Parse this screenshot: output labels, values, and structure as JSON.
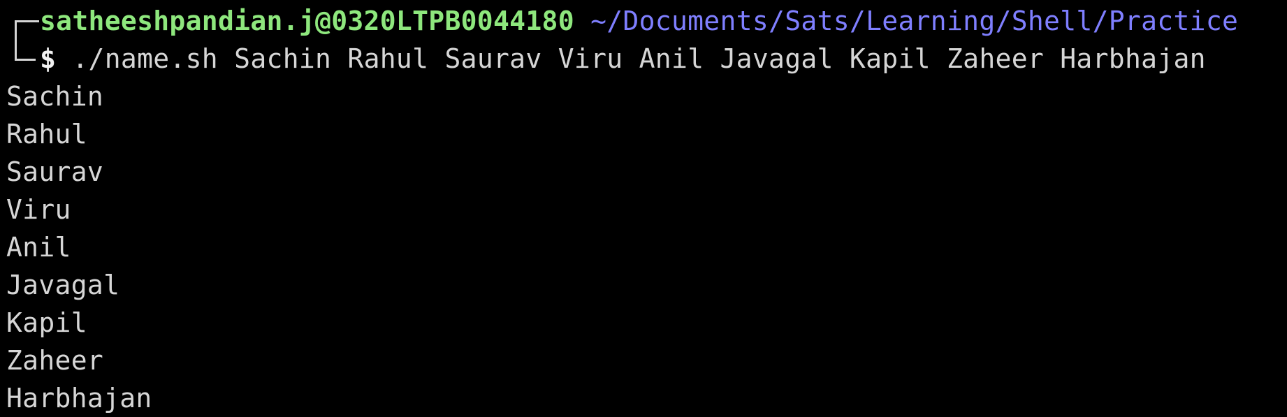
{
  "prompt": {
    "user_host": "satheeshpandian.j@0320LTPB0044180",
    "cwd": "~/Documents/Sats/Learning/Shell/Practice",
    "symbol": "$",
    "command": "./name.sh Sachin Rahul Saurav Viru Anil Javagal Kapil Zaheer Harbhajan"
  },
  "output": {
    "lines": [
      "Sachin",
      "Rahul",
      "Saurav",
      "Viru",
      "Anil",
      "Javagal",
      "Kapil",
      "Zaheer",
      "Harbhajan"
    ]
  },
  "colors": {
    "background": "#000000",
    "user_host": "#8ee77d",
    "cwd": "#7f7fff",
    "text": "#d6d6d6"
  }
}
